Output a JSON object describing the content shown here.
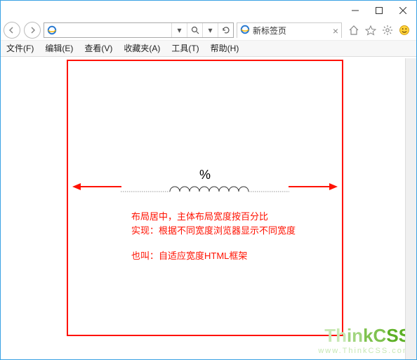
{
  "window": {
    "tab_title": "新标签页",
    "url_placeholder": ""
  },
  "menu": {
    "file": "文件(F)",
    "edit": "编辑(E)",
    "view": "查看(V)",
    "fav": "收藏夹(A)",
    "tools": "工具(T)",
    "help": "帮助(H)"
  },
  "content": {
    "percent_label": "%",
    "line1": "布局居中，主体布局宽度按百分比",
    "line2": "实现：根据不同宽度浏览器显示不同宽度",
    "line3": "也叫：自适应宽度HTML框架"
  },
  "watermark": {
    "brand": "ThinkCSS",
    "url": "www.ThinkCSS.com"
  }
}
